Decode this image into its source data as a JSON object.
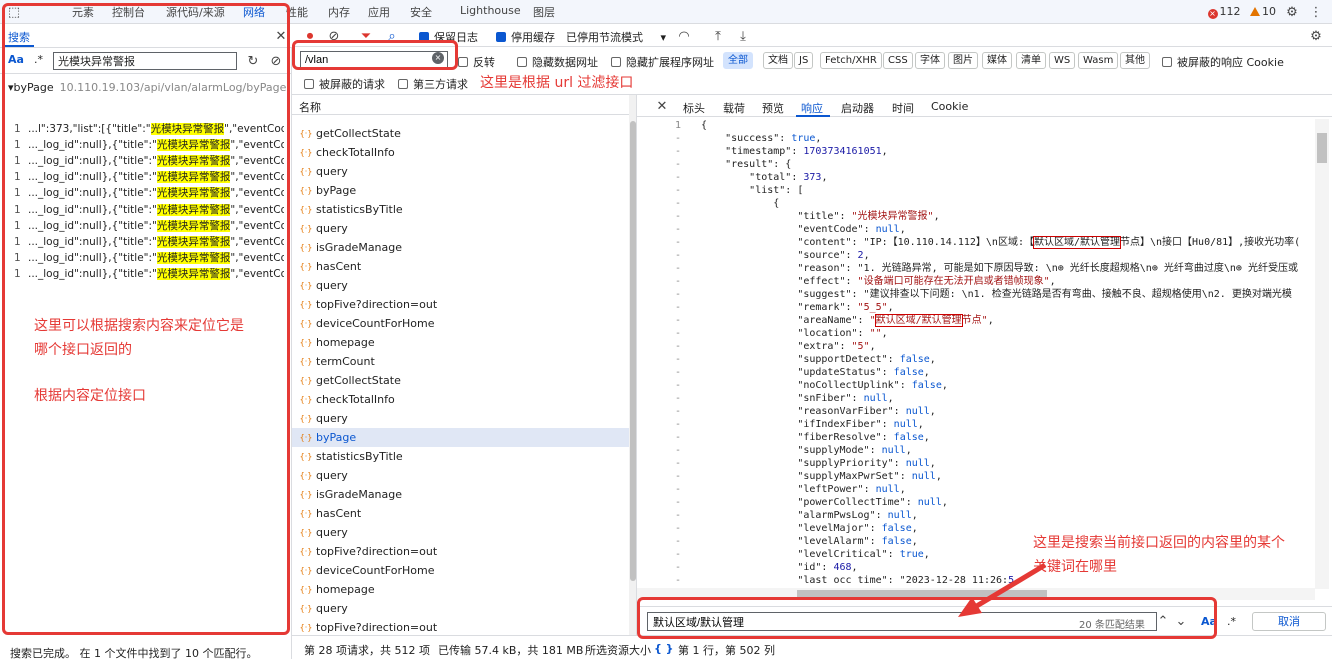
{
  "top_tabs": [
    "元素",
    "控制台",
    "源代码/来源",
    "网络",
    "性能",
    "内存",
    "应用",
    "安全",
    "Lighthouse",
    "图层"
  ],
  "active_tab": "网络",
  "error_count": "112",
  "warning_count": "10",
  "search_panel": {
    "title": "搜索",
    "aa_label": "Aa",
    "regex_label": ".*",
    "query": "光模块异常警报",
    "group_label": "byPage",
    "group_url": "10.110.19.103/api/vlan/alarmLog/byPage",
    "results": [
      {
        "num": "1",
        "pre": "...l\":373,\"list\":[{\"title\":\"",
        "hit": "光模块异常警报",
        "post": "\",\"eventCode\":nu"
      },
      {
        "num": "1",
        "pre": "..._log_id\":null},{\"title\":\"",
        "hit": "光模块异常警报",
        "post": "\",\"eventCode\":n"
      },
      {
        "num": "1",
        "pre": "..._log_id\":null},{\"title\":\"",
        "hit": "光模块异常警报",
        "post": "\",\"eventCode\":n"
      },
      {
        "num": "1",
        "pre": "..._log_id\":null},{\"title\":\"",
        "hit": "光模块异常警报",
        "post": "\",\"eventCode\":n"
      },
      {
        "num": "1",
        "pre": "..._log_id\":null},{\"title\":\"",
        "hit": "光模块异常警报",
        "post": "\",\"eventCode\":n"
      },
      {
        "num": "1",
        "pre": "..._log_id\":null},{\"title\":\"",
        "hit": "光模块异常警报",
        "post": "\",\"eventCode\":n"
      },
      {
        "num": "1",
        "pre": "..._log_id\":null},{\"title\":\"",
        "hit": "光模块异常警报",
        "post": "\",\"eventCode\":n"
      },
      {
        "num": "1",
        "pre": "..._log_id\":null},{\"title\":\"",
        "hit": "光模块异常警报",
        "post": "\",\"eventCode\":n"
      },
      {
        "num": "1",
        "pre": "..._log_id\":null},{\"title\":\"",
        "hit": "光模块异常警报",
        "post": "\",\"eventCode\":n"
      },
      {
        "num": "1",
        "pre": "..._log_id\":null},{\"title\":\"",
        "hit": "光模块异常警报",
        "post": "\",\"eventCode\":n"
      }
    ],
    "status": "搜索已完成。  在 1 个文件中找到了 10 个匹配行。"
  },
  "network_toolbar": {
    "preserve_log": "保留日志",
    "disable_cache": "停用缓存",
    "throttle": "已停用节流模式"
  },
  "filter": {
    "value": "/vlan",
    "invert": "反转",
    "hide_data_urls": "隐藏数据网址",
    "hide_ext_urls": "隐藏扩展程序网址",
    "types": [
      "全部",
      "文档",
      "JS",
      "Fetch/XHR",
      "CSS",
      "字体",
      "图片",
      "媒体",
      "清单",
      "WS",
      "Wasm",
      "其他"
    ],
    "blocked_cookies": "被屏蔽的响应 Cookie",
    "blocked_requests": "被屏蔽的请求",
    "third_party": "第三方请求"
  },
  "request_list": {
    "header": "名称",
    "items": [
      "getCollectState",
      "checkTotalInfo",
      "query",
      "byPage",
      "statisticsByTitle",
      "query",
      "isGradeManage",
      "hasCent",
      "query",
      "topFive?direction=out",
      "deviceCountForHome",
      "homepage",
      "termCount",
      "getCollectState",
      "checkTotalInfo",
      "query",
      "byPage",
      "statisticsByTitle",
      "query",
      "isGradeManage",
      "hasCent",
      "query",
      "topFive?direction=out",
      "deviceCountForHome",
      "homepage",
      "query",
      "topFive?direction=out"
    ],
    "selected_index": 16
  },
  "detail_tabs": [
    "标头",
    "载荷",
    "预览",
    "响应",
    "启动器",
    "时间",
    "Cookie"
  ],
  "active_detail_tab": "响应",
  "code_lines": [
    {
      "ln": "1",
      "text": "{"
    },
    {
      "ln": "-",
      "text": "    \"success\": true,"
    },
    {
      "ln": "-",
      "text": "    \"timestamp\": 1703734161051,"
    },
    {
      "ln": "-",
      "text": "    \"result\": {"
    },
    {
      "ln": "-",
      "text": "        \"total\": 373,"
    },
    {
      "ln": "-",
      "text": "        \"list\": ["
    },
    {
      "ln": "-",
      "text": "            {"
    },
    {
      "ln": "-",
      "text": "                \"title\": \"光模块异常警报\","
    },
    {
      "ln": "-",
      "text": "                \"eventCode\": null,"
    },
    {
      "ln": "-",
      "text": "                \"content\": \"IP:【10.110.14.112】\\n区域:【默认区域/默认管理节点】\\n接口【Hu0/81】,接收光功率("
    },
    {
      "ln": "-",
      "text": "                \"source\": 2,"
    },
    {
      "ln": "-",
      "text": "                \"reason\": \"1. 光链路异常, 可能是如下原因导致: \\n⊕ 光纤长度超规格\\n⊕ 光纤弯曲过度\\n⊕ 光纤受压或"
    },
    {
      "ln": "-",
      "text": "                \"effect\": \"设备端口可能存在无法开启或者错帧现象\","
    },
    {
      "ln": "-",
      "text": "                \"suggest\": \"建议排查以下问题: \\n1. 检查光链路是否有弯曲、接触不良、超规格使用\\n2. 更换对端光模"
    },
    {
      "ln": "-",
      "text": "                \"remark\": \"5_5\","
    },
    {
      "ln": "-",
      "text": "                \"areaName\": \"默认区域/默认管理节点\","
    },
    {
      "ln": "-",
      "text": "                \"location\": \"\","
    },
    {
      "ln": "-",
      "text": "                \"extra\": \"5\","
    },
    {
      "ln": "-",
      "text": "                \"supportDetect\": false,"
    },
    {
      "ln": "-",
      "text": "                \"updateStatus\": false,"
    },
    {
      "ln": "-",
      "text": "                \"noCollectUplink\": false,"
    },
    {
      "ln": "-",
      "text": "                \"snFiber\": null,"
    },
    {
      "ln": "-",
      "text": "                \"reasonVarFiber\": null,"
    },
    {
      "ln": "-",
      "text": "                \"ifIndexFiber\": null,"
    },
    {
      "ln": "-",
      "text": "                \"fiberResolve\": false,"
    },
    {
      "ln": "-",
      "text": "                \"supplyMode\": null,"
    },
    {
      "ln": "-",
      "text": "                \"supplyPriority\": null,"
    },
    {
      "ln": "-",
      "text": "                \"supplyMaxPwrSet\": null,"
    },
    {
      "ln": "-",
      "text": "                \"leftPower\": null,"
    },
    {
      "ln": "-",
      "text": "                \"powerCollectTime\": null,"
    },
    {
      "ln": "-",
      "text": "                \"alarmPwsLog\": null,"
    },
    {
      "ln": "-",
      "text": "                \"levelMajor\": false,"
    },
    {
      "ln": "-",
      "text": "                \"levelAlarm\": false,"
    },
    {
      "ln": "-",
      "text": "                \"levelCritical\": true,"
    },
    {
      "ln": "-",
      "text": "                \"id\": 468,"
    },
    {
      "ln": "-",
      "text": "                \"last_occ_time\": \"2023-12-28 11:26:5"
    }
  ],
  "find_bar": {
    "query": "默认区域/默认管理",
    "count": "20 条匹配结果",
    "aa_label": "Aa",
    "regex_label": ".*",
    "cancel": "取消"
  },
  "status_bar": {
    "requests": "第 28 项请求，共 512 项",
    "transferred": "已传输 57.4 kB，共 181 MB",
    "resources": "所选资源大小",
    "position": "第 1 行，第 502 列",
    "braces": "{ }"
  },
  "annotations": {
    "filter_note": "这里是根据 url 过滤接口",
    "search_note_1": "这里可以根据搜索内容来定位它是",
    "search_note_2": "哪个接口返回的",
    "search_note_3": "根据内容定位接口",
    "find_note_1": "这里是搜索当前接口返回的内容里的某个",
    "find_note_2": "关键词在哪里"
  },
  "colors": {
    "annotation_red": "#e53935",
    "accent_blue": "#0b57d0",
    "highlight": "#ffff00"
  }
}
